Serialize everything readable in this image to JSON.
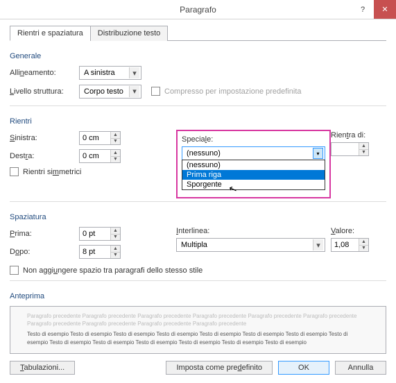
{
  "title": "Paragrafo",
  "tabs": {
    "indent": "Rientri e spaziatura",
    "dist": "Distribuzione testo"
  },
  "general": {
    "legend": "Generale",
    "align_label": "Allineamento:",
    "align_value": "A sinistra",
    "level_label": "Livello struttura:",
    "level_value": "Corpo testo",
    "collapsed": "Compresso per impostazione predefinita"
  },
  "indent": {
    "legend": "Rientri",
    "left_label": "Sinistra:",
    "left_value": "0 cm",
    "right_label": "Destra:",
    "right_value": "0 cm",
    "mirror": "Rientri simmetrici",
    "special_label": "Speciale:",
    "special_value": "(nessuno)",
    "special_opts": [
      "(nessuno)",
      "Prima riga",
      "Sporgente"
    ],
    "by_label": "Rientra di:",
    "by_value": ""
  },
  "spacing": {
    "legend": "Spaziatura",
    "before_label": "Prima:",
    "before_value": "0 pt",
    "after_label": "Dopo:",
    "after_value": "8 pt",
    "line_label": "Interlinea:",
    "line_value": "Multipla",
    "at_label": "Valore:",
    "at_value": "1,08",
    "noadd": "Non aggiungere spazio tra paragrafi dello stesso stile"
  },
  "preview": {
    "legend": "Anteprima",
    "grey": "Paragrafo precedente Paragrafo precedente Paragrafo precedente Paragrafo precedente Paragrafo precedente Paragrafo precedente Paragrafo precedente Paragrafo precedente Paragrafo precedente Paragrafo precedente",
    "black": "Testo di esempio Testo di esempio Testo di esempio Testo di esempio Testo di esempio Testo di esempio Testo di esempio Testo di esempio Testo di esempio Testo di esempio Testo di esempio Testo di esempio Testo di esempio Testo di esempio"
  },
  "footer": {
    "tabs": "Tabulazioni...",
    "default": "Imposta come predefinito",
    "ok": "OK",
    "cancel": "Annulla"
  }
}
